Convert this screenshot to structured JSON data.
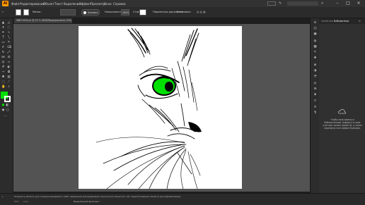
{
  "menu": {
    "logo": "Ai",
    "items": [
      "Файл",
      "Редактирование",
      "Объект",
      "Текст",
      "Выделение",
      "Эффект",
      "Просмотр",
      "Окно",
      "Справка"
    ]
  },
  "control_bar": {
    "stroke_label": "Мазок:",
    "style_preset": "Базовая",
    "opacity_label": "Непрозрачность:",
    "opacity_value": "100%",
    "style_label": "Стиль:",
    "settings_button": "Параметры документа",
    "prefs_button": "Установки"
  },
  "document": {
    "tab_title": "9887-5054.ai @ 52 % (RGB/Предпросмотр GPU)"
  },
  "right_panel": {
    "tabs": [
      "Свойства",
      "Библиотеки"
    ],
    "message": "Чтобы пользоваться библиотеками, войдите в свою учетную запись Adobe ID, а затем перезапустите Adobe Illustrator."
  },
  "status": {
    "hint": "Поменять область для позиционирования / Shift: изменение для выделения нескольких объектов / Alt: перетаскивание объекта для дублирования",
    "zoom": "52%",
    "mode": "Выделенный фрагмент"
  },
  "colors": {
    "fill": "#00e000",
    "eye": "#00e000",
    "accent": "#ff9a00"
  },
  "icons": [
    "search-icon",
    "arrange-icon",
    "brush-icon",
    "type-icon",
    "libraries-icon",
    "cc-cloud-icon"
  ]
}
